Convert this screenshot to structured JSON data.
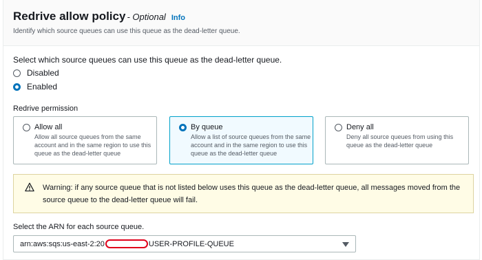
{
  "header": {
    "title": "Redrive allow policy",
    "optional": "- Optional",
    "info": "Info",
    "description": "Identify which source queues can use this queue as the dead-letter queue."
  },
  "question": "Select which source queues can use this queue as the dead-letter queue.",
  "status_options": {
    "disabled": {
      "label": "Disabled",
      "checked": false
    },
    "enabled": {
      "label": "Enabled",
      "checked": true
    }
  },
  "redrive_permission": {
    "label": "Redrive permission",
    "tiles": [
      {
        "title": "Allow all",
        "description": "Allow all source queues from the same account and in the same region to use this queue as the dead-letter queue",
        "selected": false
      },
      {
        "title": "By queue",
        "description": "Allow a list of source queues from the same account and in the same region to use this queue as the dead-letter queue",
        "selected": true
      },
      {
        "title": "Deny all",
        "description": "Deny all source queues from using this queue as the dead-letter queue",
        "selected": false
      }
    ]
  },
  "warning": {
    "icon": "warning-triangle-icon",
    "text": "Warning: if any source queue that is not listed below uses this queue as the dead-letter queue, all messages moved from the source queue to the dead-letter queue will fail."
  },
  "arn_select": {
    "label": "Select the ARN for each source queue.",
    "value_prefix": "arn:aws:sqs:us-east-2:20",
    "value_suffix": "USER-PROFILE-QUEUE"
  },
  "colors": {
    "accent": "#0073bb",
    "selected_border": "#00a1c9",
    "warning_bg": "#fffce6",
    "redaction": "#e0001a"
  }
}
